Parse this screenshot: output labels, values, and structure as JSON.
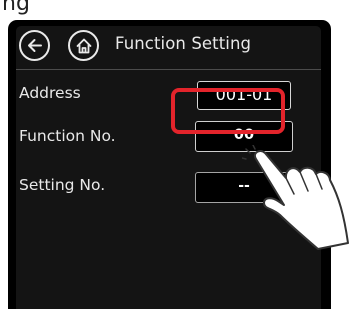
{
  "top_fragment": "ng",
  "header": {
    "title": "Function Setting",
    "back_icon": "back-arrow-icon",
    "home_icon": "home-icon"
  },
  "rows": [
    {
      "label": "Address",
      "value": "001-01"
    },
    {
      "label": "Function No.",
      "value": "00"
    },
    {
      "label": "Setting No.",
      "value": "--"
    }
  ],
  "colors": {
    "screen_background": "#141414",
    "text": "#e9e9e9",
    "highlight": "#e3242b"
  },
  "annotation": {
    "highlight_target": "function-no-value-box",
    "pointer_icon": "tapping-hand-icon"
  }
}
